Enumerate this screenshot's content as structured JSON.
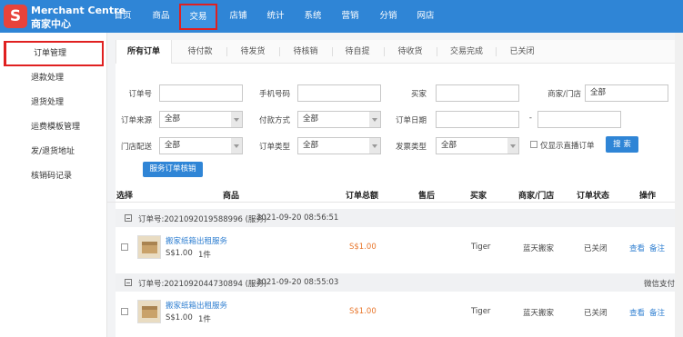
{
  "brand": {
    "logo_letter": "S",
    "name_en": "Merchant Centre",
    "name_cn": "商家中心",
    "color": "#e8433b"
  },
  "nav": {
    "items": [
      "首页",
      "商品",
      "交易",
      "店铺",
      "统计",
      "系统",
      "营销",
      "分销",
      "网店"
    ],
    "active": "交易",
    "color": "#2f85d6"
  },
  "sidebar": {
    "items": [
      "订单管理",
      "退款处理",
      "退货处理",
      "运费模板管理",
      "发/退货地址",
      "核销码记录"
    ],
    "active": "订单管理"
  },
  "tabs": [
    "所有订单",
    "待付款",
    "待发货",
    "待核销",
    "待自提",
    "待收货",
    "交易完成",
    "已关闭"
  ],
  "filters": {
    "order_no": "订单号",
    "phone": "手机号码",
    "buyer": "买家",
    "merchant_store": "商家/门店",
    "merchant_store_value": "全部",
    "order_source": "订单来源",
    "order_source_value": "全部",
    "pay_method": "付款方式",
    "pay_method_value": "全部",
    "order_date": "订单日期",
    "date_sep": "-",
    "store_delivery": "门店配送",
    "store_delivery_value": "全部",
    "order_type": "订单类型",
    "order_type_value": "全部",
    "invoice_type": "发票类型",
    "invoice_type_value": "全部",
    "live_only": "仅显示直播订单",
    "search_button": "搜 索",
    "service_verify_button": "服务订单核销"
  },
  "table": {
    "headers": [
      "选择",
      "商品",
      "订单总额",
      "售后",
      "买家",
      "商家/门店",
      "订单状态",
      "操作"
    ],
    "orders": [
      {
        "order_no": "订单号:2021092019588996 (服务)",
        "time": "2021-09-20 08:56:51",
        "pay_note": "",
        "product": "搬家纸箱出租服务",
        "unit_price": "S$1.00",
        "qty": "1件",
        "total": "S$1.00",
        "buyer": "Tiger",
        "merchant": "蓝天搬家",
        "status": "已关闭",
        "view": "查看",
        "note": "备注"
      },
      {
        "order_no": "订单号:2021092044730894 (服务)",
        "time": "2021-09-20 08:55:03",
        "pay_note": "微信支付",
        "product": "搬家纸箱出租服务",
        "unit_price": "S$1.00",
        "qty": "1件",
        "total": "S$1.00",
        "buyer": "Tiger",
        "merchant": "蓝天搬家",
        "status": "已关闭",
        "view": "查看",
        "note": "备注"
      }
    ]
  }
}
